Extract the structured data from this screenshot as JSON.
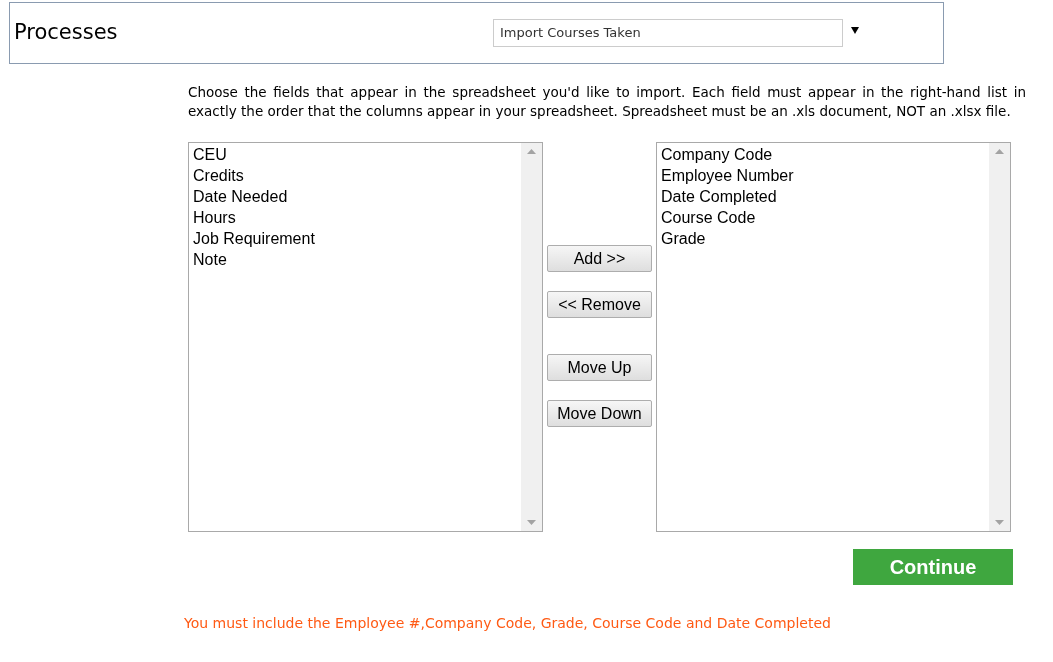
{
  "header": {
    "title": "Processes",
    "process_select": {
      "value": "Import Courses Taken"
    }
  },
  "instructions": "Choose the fields that appear in the spreadsheet you'd like to import. Each field must appear in the right-hand list in exactly the order that the columns appear in your spreadsheet. Spreadsheet must be an .xls document, NOT an .xlsx file.",
  "available_fields": [
    {
      "label": "CEU"
    },
    {
      "label": "Credits"
    },
    {
      "label": "Date Needed"
    },
    {
      "label": "Hours"
    },
    {
      "label": "Job Requirement"
    },
    {
      "label": "Note"
    }
  ],
  "selected_fields": [
    {
      "label": "Company Code"
    },
    {
      "label": "Employee Number"
    },
    {
      "label": "Date Completed"
    },
    {
      "label": "Course Code"
    },
    {
      "label": "Grade"
    }
  ],
  "buttons": {
    "add": "Add >>",
    "remove": "<< Remove",
    "move_up": "Move Up",
    "move_down": "Move Down"
  },
  "continue_button": "Continue",
  "message": "You must include the Employee #,Company Code, Grade, Course Code and Date Completed"
}
